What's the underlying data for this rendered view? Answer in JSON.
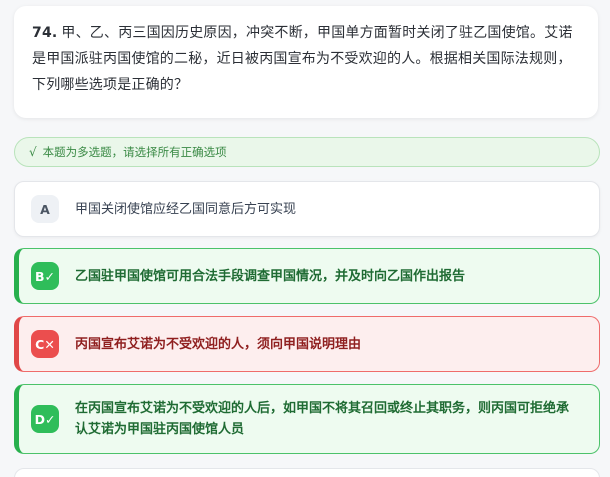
{
  "question": {
    "number": "74.",
    "text": "甲、乙、丙三国因历史原因，冲突不断，甲国单方面暂时关闭了驻乙国使馆。艾诺是甲国派驻丙国使馆的二秘，近日被丙国宣布为不受欢迎的人。根据相关国际法规则，下列哪些选项是正确的？"
  },
  "hint": {
    "check": "√",
    "text": "本题为多选题，请选择所有正确选项"
  },
  "options": [
    {
      "badge": "A",
      "text": "甲国关闭使馆应经乙国同意后方可实现",
      "state": "neutral"
    },
    {
      "badge": "B✓",
      "text": "乙国驻甲国使馆可用合法手段调查甲国情况，并及时向乙国作出报告",
      "state": "correct"
    },
    {
      "badge": "C✕",
      "text": "丙国宣布艾诺为不受欢迎的人，须向甲国说明理由",
      "state": "wrong"
    },
    {
      "badge": "D✓",
      "text": "在丙国宣布艾诺为不受欢迎的人后，如甲国不将其召回或终止其职务，则丙国可拒绝承认艾诺为甲国驻丙国使馆人员",
      "state": "correct"
    }
  ],
  "colors": {
    "correct": "#2fbd5a",
    "wrong": "#eb4e4e",
    "hint": "#3a8a45"
  }
}
